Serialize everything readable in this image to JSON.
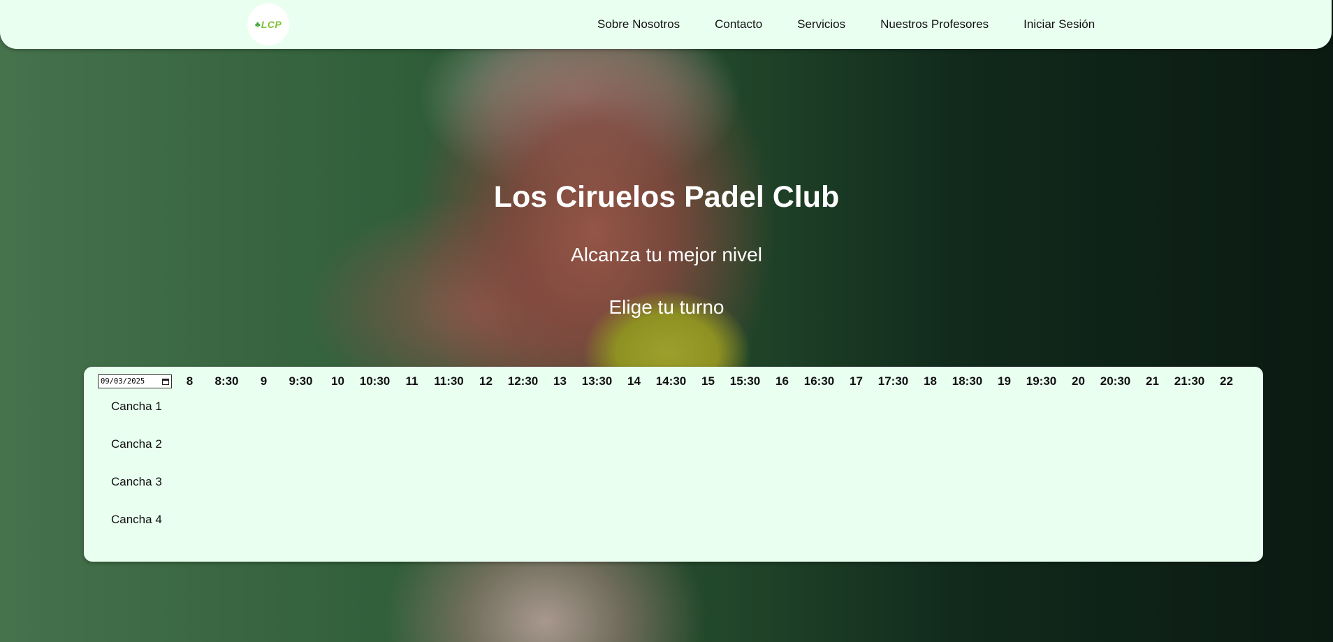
{
  "nav": {
    "logo_text": "LCP",
    "links": [
      "Sobre Nosotros",
      "Contacto",
      "Servicios",
      "Nuestros Profesores",
      "Iniciar Sesión"
    ]
  },
  "hero": {
    "title": "Los Ciruelos Padel Club",
    "subtitle": "Alcanza tu mejor nivel",
    "cta": "Elige tu turno"
  },
  "booking": {
    "date_value": "09/03/2025",
    "times": [
      "8",
      "8:30",
      "9",
      "9:30",
      "10",
      "10:30",
      "11",
      "11:30",
      "12",
      "12:30",
      "13",
      "13:30",
      "14",
      "14:30",
      "15",
      "15:30",
      "16",
      "16:30",
      "17",
      "17:30",
      "18",
      "18:30",
      "19",
      "19:30",
      "20",
      "20:30",
      "21",
      "21:30",
      "22"
    ],
    "courts": [
      "Cancha 1",
      "Cancha 2",
      "Cancha 3",
      "Cancha 4"
    ]
  },
  "colors": {
    "panel_bg": "#e9fff0",
    "logo_green": "#7fc238"
  },
  "icons": {
    "logo": "leaf-icon",
    "date_picker": "calendar-icon"
  }
}
